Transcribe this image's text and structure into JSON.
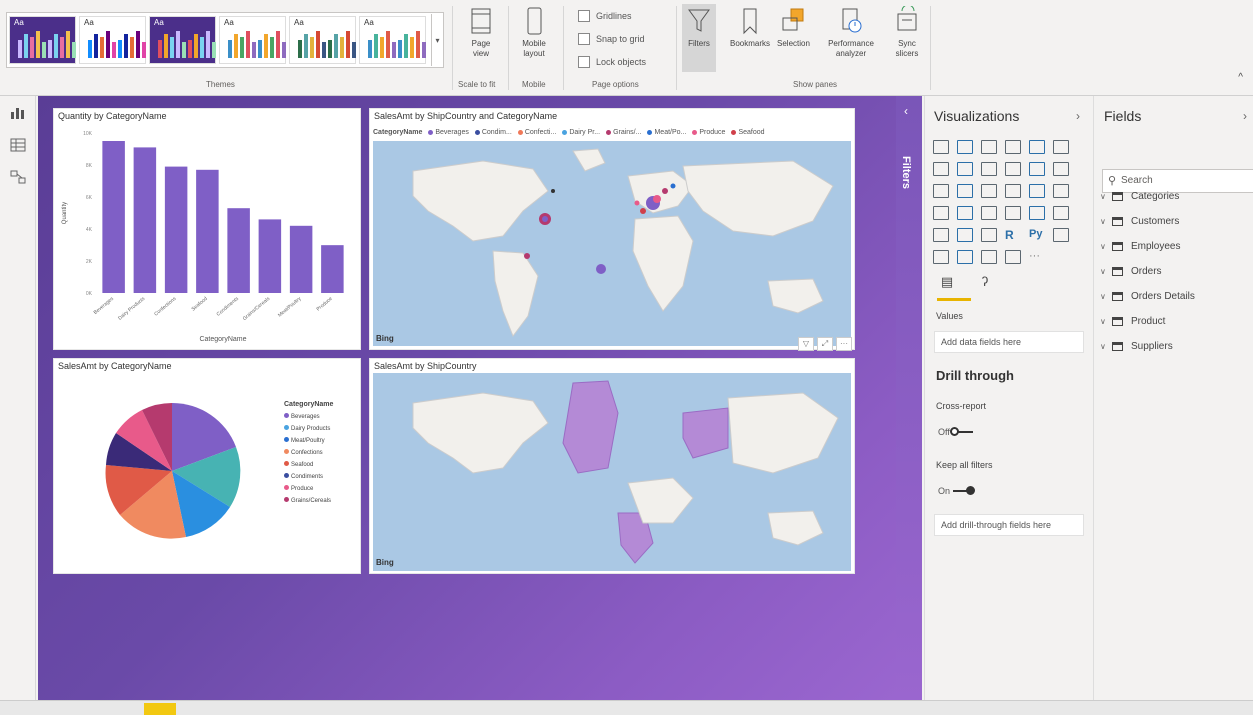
{
  "ribbon": {
    "themes_label": "Themes",
    "theme_tiles": [
      {
        "aa": "Aa",
        "bg": "#4b2f8a",
        "aa_color": "#ffffff",
        "bar_colors": [
          "#c9b8ff",
          "#7ad3f0",
          "#e86fa0",
          "#f2c14e",
          "#9ae0b5"
        ]
      },
      {
        "aa": "Aa",
        "bg": "#ffffff",
        "aa_color": "#333333",
        "bar_colors": [
          "#118dff",
          "#12239e",
          "#e66c37",
          "#6b007b",
          "#e044a7"
        ]
      },
      {
        "aa": "Aa",
        "bg": "#4b2f8a",
        "aa_color": "#ffffff",
        "bar_colors": [
          "#e04f5f",
          "#f2a62b",
          "#7ad3f0",
          "#c9b8ff",
          "#9ae0b5"
        ]
      },
      {
        "aa": "Aa",
        "bg": "#ffffff",
        "aa_color": "#333333",
        "bar_colors": [
          "#3a8fc8",
          "#f2a62b",
          "#4aa564",
          "#e04f5f",
          "#8e6bbf"
        ]
      },
      {
        "aa": "Aa",
        "bg": "#ffffff",
        "aa_color": "#333333",
        "bar_colors": [
          "#2c6e49",
          "#56a3a6",
          "#e3b23c",
          "#d64933",
          "#3a5683"
        ]
      },
      {
        "aa": "Aa",
        "bg": "#ffffff",
        "aa_color": "#333333",
        "bar_colors": [
          "#3a8fc8",
          "#47b39c",
          "#f2a62b",
          "#e05a47",
          "#8e6bbf"
        ]
      }
    ],
    "page_view": "Page view",
    "scale_label": "Scale to fit",
    "mobile_layout": "Mobile layout",
    "mobile_label": "Mobile",
    "gridlines": "Gridlines",
    "snap_to_grid": "Snap to grid",
    "lock_objects": "Lock objects",
    "page_options": "Page options",
    "filters": "Filters",
    "bookmarks": "Bookmarks",
    "selection": "Selection",
    "performance": "Performance analyzer",
    "sync_slicers": "Sync slicers",
    "show_panes": "Show panes"
  },
  "visuals": {
    "bar": {
      "title": "Quantity by CategoryName",
      "xlabel": "CategoryName",
      "ylabel": "Quantity"
    },
    "map1": {
      "title": "SalesAmt by ShipCountry and CategoryName",
      "legend_title": "CategoryName",
      "legend": [
        {
          "name": "Beverages",
          "color": "#7f5fc6"
        },
        {
          "name": "Condim...",
          "color": "#3a4ea0"
        },
        {
          "name": "Confecti...",
          "color": "#f07858"
        },
        {
          "name": "Dairy Pr...",
          "color": "#4aa3e0"
        },
        {
          "name": "Grains/...",
          "color": "#b53a6e"
        },
        {
          "name": "Meat/Po...",
          "color": "#2a6fd0"
        },
        {
          "name": "Produce",
          "color": "#e85a8a"
        },
        {
          "name": "Seafood",
          "color": "#d0404a"
        }
      ],
      "bing": "Bing"
    },
    "pie": {
      "title": "SalesAmt by CategoryName",
      "legend_title": "CategoryName",
      "legend": [
        {
          "name": "Beverages",
          "color": "#7f5fc6"
        },
        {
          "name": "Dairy Products",
          "color": "#4aa3e0"
        },
        {
          "name": "Meat/Poultry",
          "color": "#2a6fd0"
        },
        {
          "name": "Confections",
          "color": "#f08a60"
        },
        {
          "name": "Seafood",
          "color": "#e05a47"
        },
        {
          "name": "Condiments",
          "color": "#3a4ea0"
        },
        {
          "name": "Produce",
          "color": "#e85a8a"
        },
        {
          "name": "Grains/Cereals",
          "color": "#b53a6e"
        }
      ]
    },
    "map2": {
      "title": "SalesAmt by ShipCountry",
      "bing": "Bing"
    }
  },
  "chart_data": {
    "type": "bar",
    "title": "Quantity by CategoryName",
    "xlabel": "CategoryName",
    "ylabel": "Quantity",
    "categories": [
      "Beverages",
      "Dairy Products",
      "Confections",
      "Seafood",
      "Condiments",
      "Grains/Cereals",
      "Meat/Poultry",
      "Produce"
    ],
    "values": [
      9500,
      9100,
      7900,
      7700,
      5300,
      4600,
      4200,
      2990
    ],
    "ylim": [
      0,
      10000
    ],
    "color": "#7f5fc6"
  },
  "filters_pane": {
    "label": "Filters"
  },
  "viz_pane": {
    "title": "Visualizations",
    "values_label": "Values",
    "add_data": "Add data fields here",
    "drill_title": "Drill through",
    "cross_report": "Cross-report",
    "cross_state": "Off",
    "keep_filters": "Keep all filters",
    "keep_state": "On",
    "add_drill": "Add drill-through fields here"
  },
  "fields_pane": {
    "title": "Fields",
    "search_placeholder": "Search",
    "tables": [
      "Categories",
      "Customers",
      "Employees",
      "Orders",
      "Orders Details",
      "Product",
      "Suppliers"
    ]
  }
}
